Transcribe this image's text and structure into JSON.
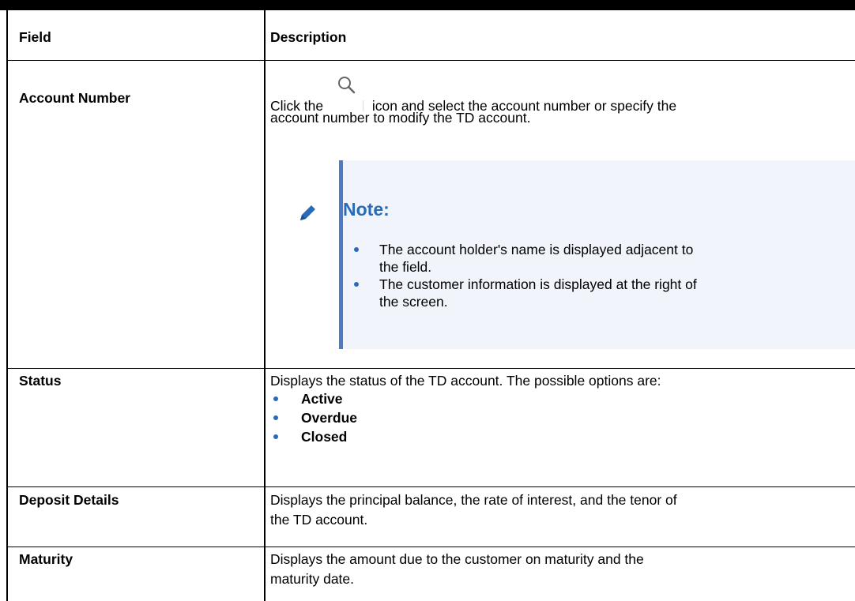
{
  "table": {
    "header": {
      "field": "Field",
      "description": "Description"
    },
    "rows": {
      "account_number": {
        "field": "Account Number",
        "desc_before_icon": "Click the",
        "desc_after_icon": "icon and select the account number or specify the",
        "desc_line2": "account number to modify the TD account.",
        "icon": "search-icon",
        "note": {
          "title": "Note:",
          "icon": "pencil-icon",
          "items": [
            {
              "line1": "The account holder's name is displayed adjacent to",
              "line2": "the field."
            },
            {
              "line1": "The customer information is displayed at the right of",
              "line2": "the screen."
            }
          ]
        }
      },
      "status": {
        "field": "Status",
        "description": "Displays the status of the TD account. The possible options are:",
        "options": [
          "Active",
          "Overdue",
          "Closed"
        ]
      },
      "deposit_details": {
        "field": "Deposit Details",
        "line1": "Displays the principal balance, the rate of interest, and the tenor of",
        "line2": "the TD account."
      },
      "maturity": {
        "field": "Maturity",
        "line1": "Displays the amount due to the customer on maturity and the",
        "line2": "maturity date."
      }
    }
  },
  "colors": {
    "note_accent": "#2a6bb8",
    "note_bar": "#4a7bc4",
    "note_background": "#f1f5fb"
  }
}
